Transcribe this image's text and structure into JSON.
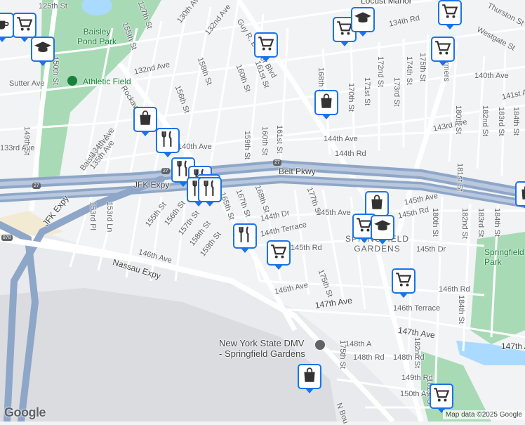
{
  "colors": {
    "background": "#f1f3f4",
    "road": "#ffffff",
    "highway": "#8ea6c8",
    "park": "#a8dab5",
    "water": "#aadaff",
    "airport": "#e8eaed",
    "pin_border": "#1a73e8"
  },
  "labels": {
    "locust_manor": "Locust Manor",
    "baisley_pond_park": "Baisley\nPond Park",
    "athletic_field": "Athletic Field",
    "springfield_gardens": "SPRINGFIELD\nGARDENS",
    "springfield_park": "Springfield\nPark",
    "dmv": "New York State DMV\n- Springfield Gardens",
    "belt_pkwy": "Belt Pkwy",
    "jfk_expy": "JFK Expy",
    "jfk_expy_2": "JFK Expy",
    "nassau_expy": "Nassau Expy",
    "rockaway_blvd": "Rockaway Blvd",
    "guy_r_brewer": "Guy R. Brewer Blvd",
    "baisley_blvd": "Baisley Blvd",
    "farmers": "Farmers",
    "n_boundary": "N Bou",
    "westgate": "Westgate St",
    "thurston": "Thurston St",
    "st_125": "125th St",
    "st_130ave": "130th Ave",
    "st_132nd_ave": "132nd Ave",
    "st_132ave": "132nd Ave",
    "st_134rd": "134th Rd",
    "st_134ave": "134th Ave",
    "st_135ave": "135th Ave",
    "st_133rd": "133rd Ave",
    "st_sutter": "Sutter Ave",
    "st_150th": "150th St",
    "st_155th": "155th St",
    "st_156th_top": "156th St",
    "st_158th_top": "158th St",
    "st_160th_top": "160th St",
    "st_161st_top": "161st St",
    "st_168th": "168th St",
    "st_170th": "170th St",
    "st_171st": "171st St",
    "st_172nd": "172nd St",
    "st_173rd": "173rd St",
    "st_174th": "174th St",
    "st_175th": "175th St",
    "st_140ave_r": "140th Ave",
    "st_141st": "141st Ave",
    "st_143rd": "143rd Ave",
    "st_144ave": "144th Ave",
    "st_144rd": "144th Rd",
    "st_140ave": "140th Ave",
    "st_149th": "149th St",
    "st_180th": "180th St",
    "st_182nd": "182nd St",
    "st_183rd": "183rd St",
    "st_184th": "184th St",
    "st_181st": "181st St",
    "st_159th": "159th St",
    "st_160th": "160th St",
    "st_161st": "161st St",
    "st_167th": "167th St",
    "st_168th_b": "168th St",
    "st_165th": "165th St",
    "st_144dr": "144th Dr",
    "st_144terrace": "144th Terrace",
    "st_145rd": "145th Rd",
    "st_155th_b": "155th St",
    "st_156th": "156th St",
    "st_157th": "157th St",
    "st_158th": "158th St",
    "st_159th_b": "159th St",
    "st_153pl": "153rd Pl",
    "st_153ln": "153rd Ln",
    "st_146ave": "146th Ave",
    "st_146ave_b": "146th Ave",
    "st_175th_b": "175th St",
    "st_177th": "177th St",
    "st_145ave": "145th Ave",
    "st_145ave_b": "145th Ave",
    "st_145rd_b": "145th Rd",
    "st_145dr": "145th Dr",
    "st_180th_b": "180th St",
    "st_182nd_b": "182nd St",
    "st_183rd_b": "183rd St",
    "st_184th_b": "184th St",
    "st_146rd": "146th Rd",
    "st_146terrace": "146th Terrace",
    "st_147ave": "147th Ave",
    "st_147ave_b": "147th Ave",
    "st_147ave_c": "147th Ave",
    "st_148rd": "148th Rd",
    "st_148rd_b": "148th Rd",
    "st_149rd": "149th Rd",
    "st_150ave": "150th Ave",
    "st_175th_c": "175th St",
    "st_182nd_c": "182nd St",
    "st_184th_c": "184th St",
    "st_181st_b": "181st St",
    "st_148ave": "148th A",
    "st_127th": "127th St",
    "st_140ave_b": "140th Ave",
    "route_27": "27",
    "route_878": "878"
  },
  "attribution": "Map data ©2025 Google",
  "logo": "Google",
  "pins": [
    {
      "icon": "coffee-icon",
      "kind": "cafe"
    },
    {
      "icon": "shopping-cart-icon",
      "kind": "grocery"
    },
    {
      "icon": "graduation-cap-icon",
      "kind": "school"
    },
    {
      "icon": "shopping-cart-icon",
      "kind": "grocery"
    },
    {
      "icon": "graduation-cap-icon",
      "kind": "school"
    },
    {
      "icon": "shopping-cart-icon",
      "kind": "grocery"
    },
    {
      "icon": "shopping-cart-icon",
      "kind": "grocery"
    },
    {
      "icon": "shopping-cart-icon",
      "kind": "grocery"
    },
    {
      "icon": "shopping-bag-icon",
      "kind": "store"
    },
    {
      "icon": "shopping-bag-icon",
      "kind": "store"
    },
    {
      "icon": "restaurant-icon",
      "kind": "restaurant"
    },
    {
      "icon": "restaurant-icon",
      "kind": "restaurant"
    },
    {
      "icon": "restaurant-icon",
      "kind": "restaurant"
    },
    {
      "icon": "restaurant-icon",
      "kind": "restaurant"
    },
    {
      "icon": "restaurant-icon",
      "kind": "restaurant"
    },
    {
      "icon": "restaurant-icon",
      "kind": "restaurant"
    },
    {
      "icon": "restaurant-icon",
      "kind": "restaurant"
    },
    {
      "icon": "shopping-cart-icon",
      "kind": "grocery"
    },
    {
      "icon": "shopping-bag-icon",
      "kind": "store"
    },
    {
      "icon": "shopping-cart-icon",
      "kind": "grocery"
    },
    {
      "icon": "graduation-cap-icon",
      "kind": "school"
    },
    {
      "icon": "shopping-cart-icon",
      "kind": "grocery"
    },
    {
      "icon": "shopping-bag-icon",
      "kind": "store"
    },
    {
      "icon": "shopping-bag-icon",
      "kind": "store"
    },
    {
      "icon": "shopping-cart-icon",
      "kind": "grocery"
    }
  ]
}
